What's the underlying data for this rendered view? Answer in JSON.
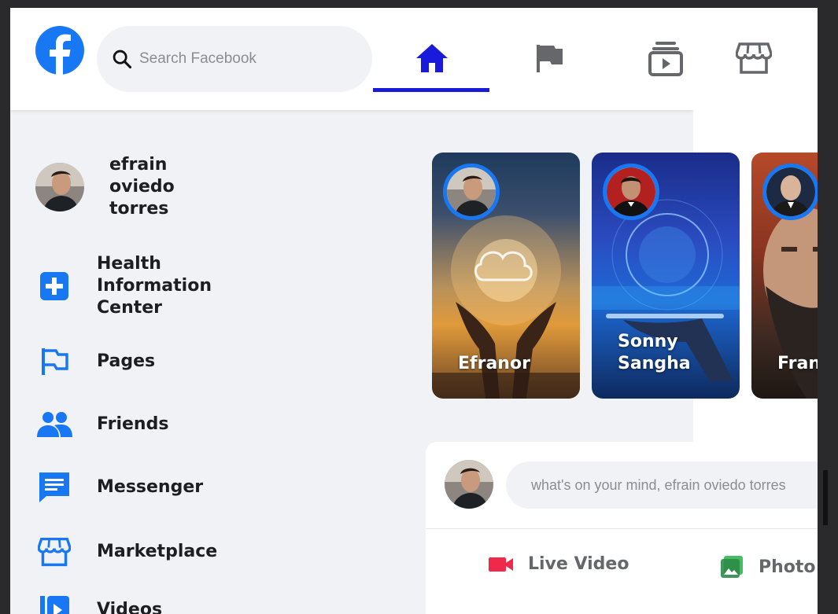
{
  "header": {
    "search": {
      "placeholder": "Search Facebook"
    },
    "nav": [
      "home-icon",
      "flag-icon",
      "watch-icon",
      "marketplace-icon"
    ]
  },
  "colors": {
    "accent": "#1877f2",
    "active_tab": "#1a1adb",
    "live_red": "#f02849",
    "photo_green": "#45bd62"
  },
  "sidebar": {
    "profile": {
      "name": "efrain oviedo torres"
    },
    "items": [
      {
        "label": "Health Information Center",
        "icon": "plus-square-icon"
      },
      {
        "label": "Pages",
        "icon": "flag-icon"
      },
      {
        "label": "Friends",
        "icon": "friends-icon"
      },
      {
        "label": "Messenger",
        "icon": "messenger-icon"
      },
      {
        "label": "Marketplace",
        "icon": "marketplace-icon"
      },
      {
        "label": "Videos",
        "icon": "video-icon"
      }
    ]
  },
  "stories": [
    {
      "name": "Efranor"
    },
    {
      "name": "Sonny Sangha"
    },
    {
      "name": "Fran"
    }
  ],
  "composer": {
    "placeholder": "what's on your mind, efrain oviedo torres",
    "actions": [
      {
        "label": "Live Video",
        "icon": "video-camera-icon"
      },
      {
        "label": "Photo",
        "icon": "photo-icon"
      }
    ]
  }
}
